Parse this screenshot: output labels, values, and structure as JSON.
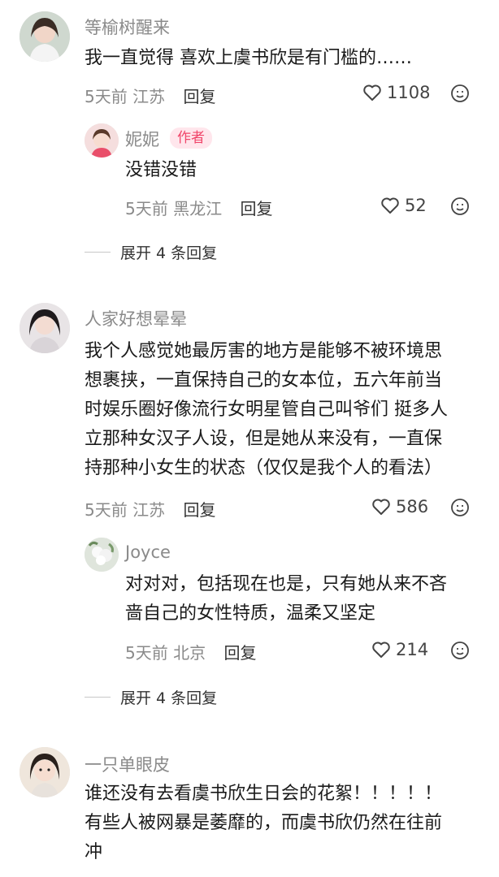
{
  "comments": [
    {
      "user": "等榆树醒来",
      "text_lines": [
        "我一直觉得 喜欢上虞书欣是有门槛的……"
      ],
      "time": "5天前",
      "location": "江苏",
      "reply_label": "回复",
      "likes": "1108",
      "replies": [
        {
          "user": "妮妮",
          "badge": "作者",
          "text_lines": [
            "没错没错"
          ],
          "time": "5天前",
          "location": "黑龙江",
          "reply_label": "回复",
          "likes": "52"
        }
      ],
      "expand_label": "展开 4 条回复"
    },
    {
      "user": "人家好想晕晕",
      "text_lines": [
        "我个人感觉她最厉害的地方是能够不被环境思",
        "想裹挟，一直保持自己的女本位，五六年前当",
        "时娱乐圈好像流行女明星管自己叫爷们 挺多人",
        "立那种女汉子人设，但是她从来没有，一直保",
        "持那种小女生的状态（仅仅是我个人的看法）"
      ],
      "time": "5天前",
      "location": "江苏",
      "reply_label": "回复",
      "likes": "586",
      "replies": [
        {
          "user": "Joyce",
          "text_lines": [
            "对对对，包括现在也是，只有她从来不吝",
            "啬自己的女性特质，温柔又坚定"
          ],
          "time": "5天前",
          "location": "北京",
          "reply_label": "回复",
          "likes": "214"
        }
      ],
      "expand_label": "展开 4 条回复"
    },
    {
      "user": "一只单眼皮",
      "text_lines": [
        "谁还没有去看虞书欣生日会的花絮！！！！！",
        "有些人被网暴是萎靡的，而虞书欣仍然在往前",
        "冲"
      ]
    }
  ],
  "icons": {
    "like": "heart-outline-icon",
    "emoji": "smiley-emoji-icon"
  },
  "colors": {
    "badge_text": "#f0466a",
    "badge_bg": "#ffe6ec",
    "meta": "#8a8a8a"
  }
}
